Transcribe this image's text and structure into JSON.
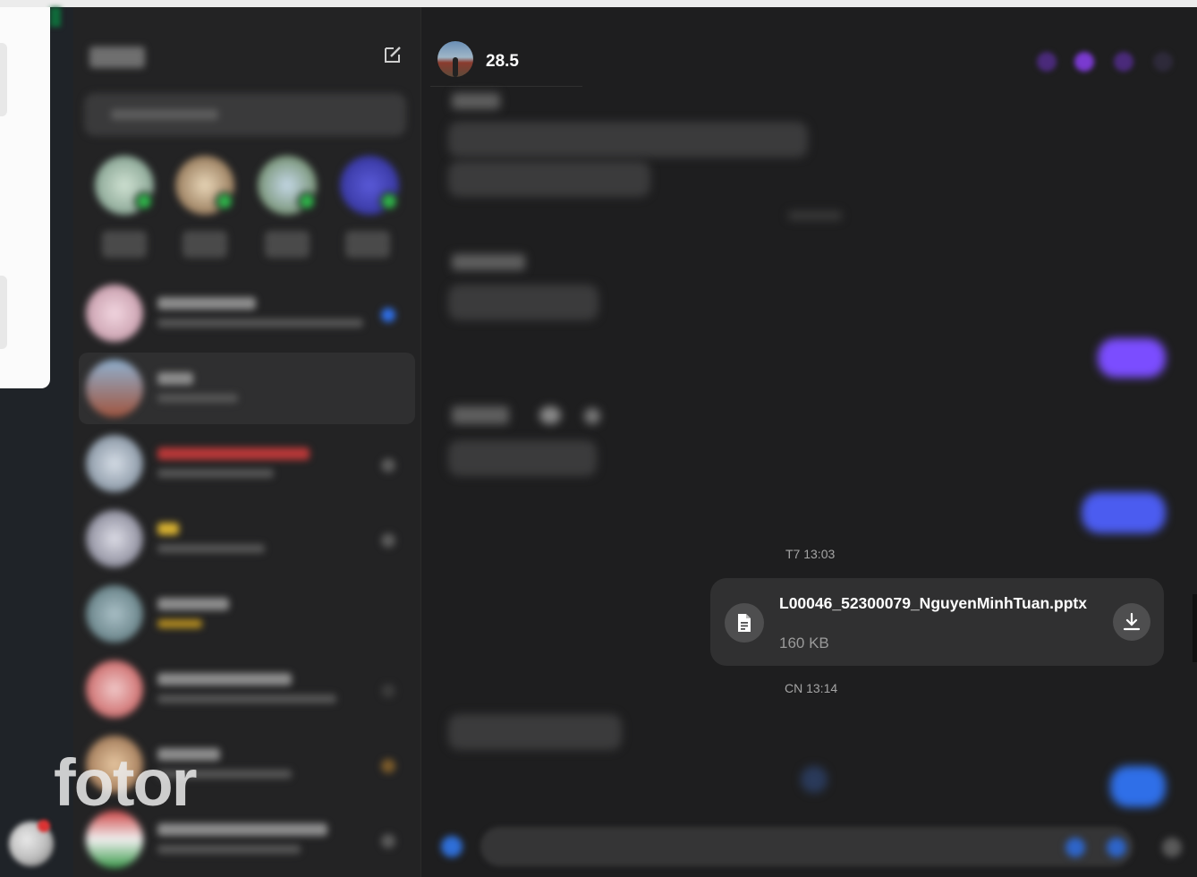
{
  "watermark": "fotor",
  "conversation": {
    "name": "28.5"
  },
  "messages": {
    "timestamp_1": "T7 13:03",
    "timestamp_2": "CN 13:14",
    "file": {
      "name": "L00046_52300079_NguyenMinhTuan.pptx",
      "size": "160 KB",
      "icon": "document-icon",
      "action_icon": "download-icon"
    }
  },
  "colors": {
    "background": "#1e1e1f",
    "sidebar": "#232324",
    "file_card": "#303031",
    "accent_purple": "#7b4dff",
    "accent_blue": "#2f6fe8"
  }
}
